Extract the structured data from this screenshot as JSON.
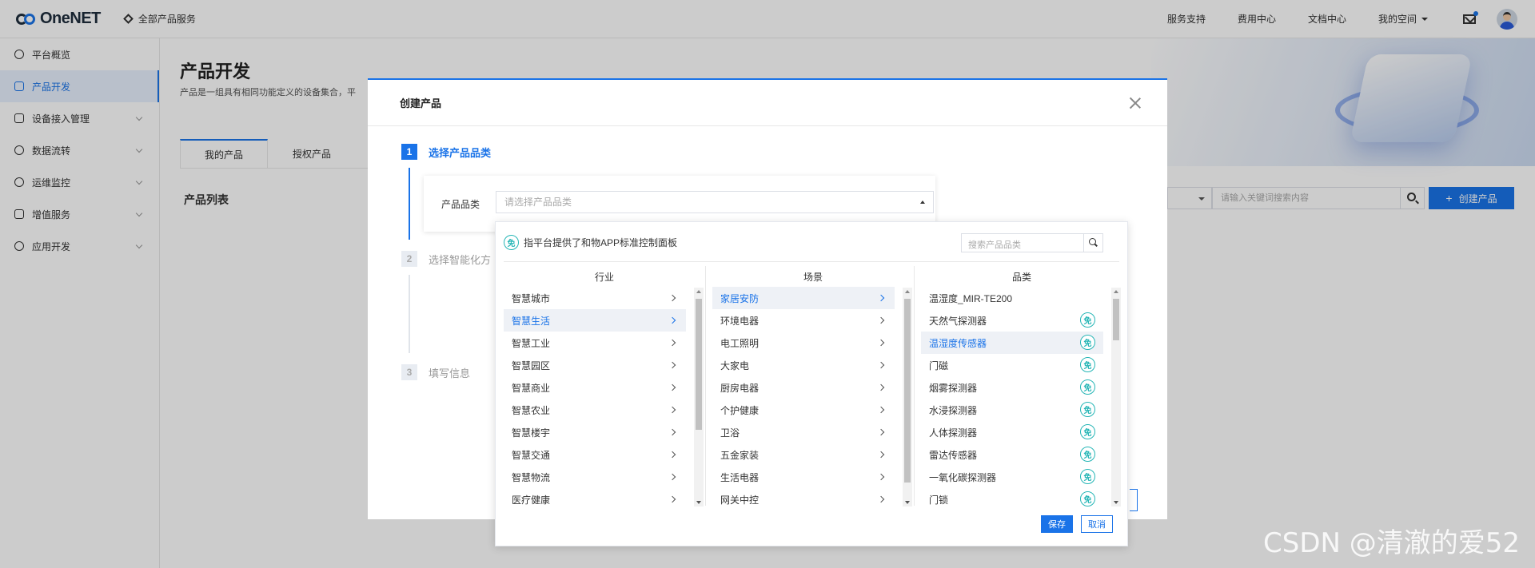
{
  "header": {
    "logo_text": "OneNET",
    "all_products": "全部产品服务",
    "nav": [
      "服务支持",
      "费用中心",
      "文档中心"
    ],
    "my_space": "我的空间"
  },
  "sidebar": {
    "items": [
      {
        "label": "平台概览",
        "icon": "dashboard-icon"
      },
      {
        "label": "产品开发",
        "icon": "cube-icon"
      },
      {
        "label": "设备接入管理",
        "icon": "device-icon"
      },
      {
        "label": "数据流转",
        "icon": "flow-icon"
      },
      {
        "label": "运维监控",
        "icon": "monitor-icon"
      },
      {
        "label": "增值服务",
        "icon": "service-icon"
      },
      {
        "label": "应用开发",
        "icon": "app-icon"
      }
    ]
  },
  "main": {
    "title": "产品开发",
    "description": "产品是一组具有相同功能定义的设备集合，平",
    "tabs": [
      "我的产品",
      "授权产品"
    ],
    "section_title": "产品列表",
    "search_placeholder": "请输入关键词搜索内容",
    "create_button": "创建产品"
  },
  "modal": {
    "title": "创建产品",
    "steps": [
      {
        "num": "1",
        "label": "选择产品品类"
      },
      {
        "num": "2",
        "label": "选择智能化方"
      },
      {
        "num": "3",
        "label": "填写信息"
      }
    ],
    "category_label": "产品品类",
    "category_placeholder": "请选择产品品类"
  },
  "dropdown": {
    "badge_text": "免",
    "note": "指平台提供了和物APP标准控制面板",
    "search_placeholder": "搜索产品品类",
    "columns": {
      "industry": {
        "header": "行业",
        "items": [
          "智慧城市",
          "智慧生活",
          "智慧工业",
          "智慧园区",
          "智慧商业",
          "智慧农业",
          "智慧楼宇",
          "智慧交通",
          "智慧物流",
          "医疗健康"
        ],
        "selected_index": 1
      },
      "scene": {
        "header": "场景",
        "items": [
          "家居安防",
          "环境电器",
          "电工照明",
          "大家电",
          "厨房电器",
          "个护健康",
          "卫浴",
          "五金家装",
          "生活电器",
          "网关中控"
        ],
        "selected_index": 0
      },
      "category": {
        "header": "品类",
        "items": [
          {
            "label": "温湿度_MIR-TE200",
            "free": false
          },
          {
            "label": "天然气探测器",
            "free": true
          },
          {
            "label": "温湿度传感器",
            "free": true
          },
          {
            "label": "门磁",
            "free": true
          },
          {
            "label": "烟雾探测器",
            "free": true
          },
          {
            "label": "水浸探测器",
            "free": true
          },
          {
            "label": "人体探测器",
            "free": true
          },
          {
            "label": "雷达传感器",
            "free": true
          },
          {
            "label": "一氧化碳探测器",
            "free": true
          },
          {
            "label": "门锁",
            "free": true
          }
        ],
        "selected_index": 2
      }
    },
    "save": "保存",
    "cancel": "取消"
  },
  "watermark": "CSDN @清澈的爱52",
  "colors": {
    "accent": "#1a73e8",
    "free_badge": "#26b6b6"
  }
}
